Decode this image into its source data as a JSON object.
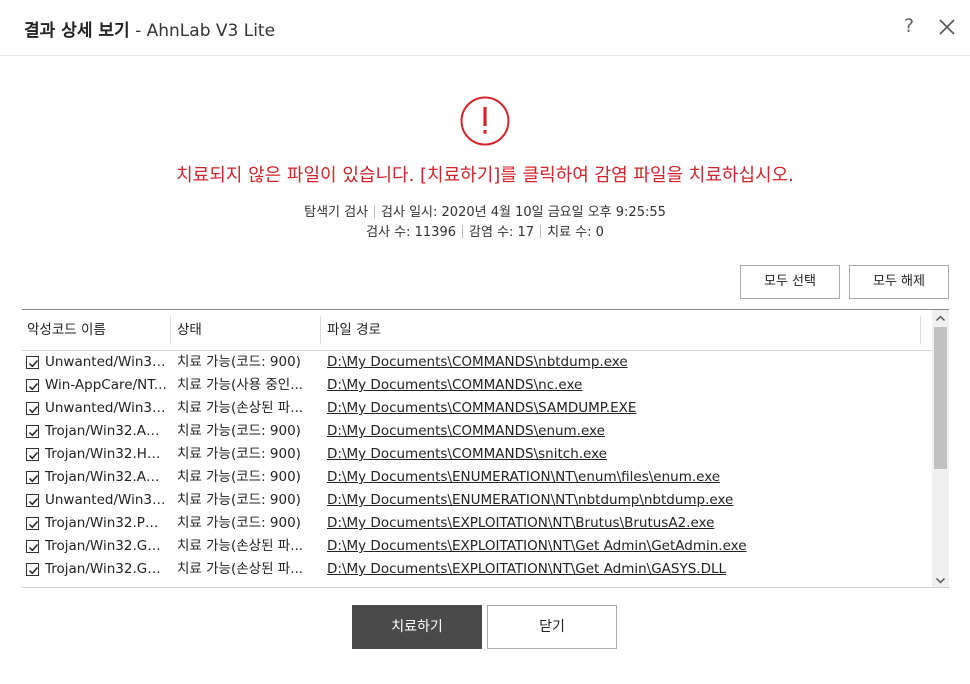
{
  "window": {
    "title_bold": "결과 상세 보기",
    "title_app": "- AhnLab V3 Lite",
    "help_label": "?"
  },
  "alert": {
    "icon": "exclamation-circle-icon",
    "message": "치료되지 않은 파일이 있습니다. [치료하기]를 클릭하여 감염 파일을 치료하십시오.",
    "color": "#d3232b"
  },
  "scan_info": {
    "type": "탐색기 검사",
    "datetime": "검사 일시: 2020년 4월 10일 금요일 오후 9:25:55",
    "scanned": "검사 수: 11396",
    "infected": "감염 수: 17",
    "treated": "치료 수: 0"
  },
  "toolbar": {
    "select_all": "모두 선택",
    "deselect_all": "모두 해제"
  },
  "table": {
    "headers": {
      "name": "악성코드 이름",
      "status": "상태",
      "path": "파일 경로"
    },
    "rows": [
      {
        "name": "Unwanted/Win32....",
        "status": "치료 가능(코드: 900)",
        "path": "D:\\My Documents\\COMMANDS\\nbtdump.exe",
        "checked": true
      },
      {
        "name": "Win-AppCare/NT...",
        "status": "치료 가능(사용 중인...",
        "path": "D:\\My Documents\\COMMANDS\\nc.exe",
        "checked": true
      },
      {
        "name": "Unwanted/Win32....",
        "status": "치료 가능(손상된 파...",
        "path": "D:\\My Documents\\COMMANDS\\SAMDUMP.EXE",
        "checked": true
      },
      {
        "name": "Trojan/Win32.Age...",
        "status": "치료 가능(코드: 900)",
        "path": "D:\\My Documents\\COMMANDS\\enum.exe",
        "checked": true
      },
      {
        "name": "Trojan/Win32.HD...",
        "status": "치료 가능(코드: 900)",
        "path": "D:\\My Documents\\COMMANDS\\snitch.exe",
        "checked": true
      },
      {
        "name": "Trojan/Win32.Age...",
        "status": "치료 가능(코드: 900)",
        "path": "D:\\My Documents\\ENUMERATION\\NT\\enum\\files\\enum.exe",
        "checked": true
      },
      {
        "name": "Unwanted/Win32....",
        "status": "치료 가능(코드: 900)",
        "path": "D:\\My Documents\\ENUMERATION\\NT\\nbtdump\\nbtdump.exe",
        "checked": true
      },
      {
        "name": "Trojan/Win32.PW...",
        "status": "치료 가능(코드: 900)",
        "path": "D:\\My Documents\\EXPLOITATION\\NT\\Brutus\\BrutusA2.exe",
        "checked": true
      },
      {
        "name": "Trojan/Win32.Get...",
        "status": "치료 가능(손상된 파...",
        "path": "D:\\My Documents\\EXPLOITATION\\NT\\Get Admin\\GetAdmin.exe",
        "checked": true
      },
      {
        "name": "Trojan/Win32.Get...",
        "status": "치료 가능(손상된 파...",
        "path": "D:\\My Documents\\EXPLOITATION\\NT\\Get Admin\\GASYS.DLL",
        "checked": true
      }
    ]
  },
  "footer": {
    "treat_button": "치료하기",
    "close_button": "닫기"
  }
}
